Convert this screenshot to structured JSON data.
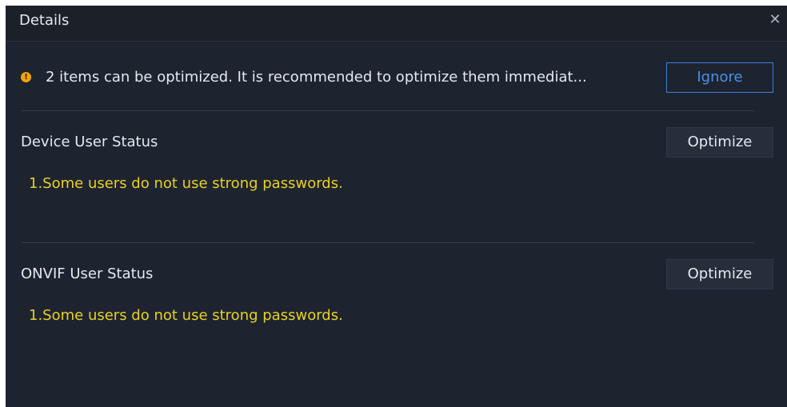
{
  "dialog": {
    "title": "Details",
    "close_icon": "close-icon"
  },
  "notice": {
    "icon": "warning-dot-icon",
    "icon_glyph": "!",
    "icon_color": "#f5a300",
    "text": "2 items can be optimized. It is recommended to optimize them immediat...",
    "ignore_label": "Ignore"
  },
  "sections": [
    {
      "title": "Device User Status",
      "button_label": "Optimize",
      "message": "1.Some users do not use strong passwords."
    },
    {
      "title": "ONVIF User Status",
      "button_label": "Optimize",
      "message": "1.Some users do not use strong passwords."
    }
  ],
  "colors": {
    "background": "#1e2330",
    "warning_text": "#e8d21f",
    "accent": "#3d7fd9"
  }
}
